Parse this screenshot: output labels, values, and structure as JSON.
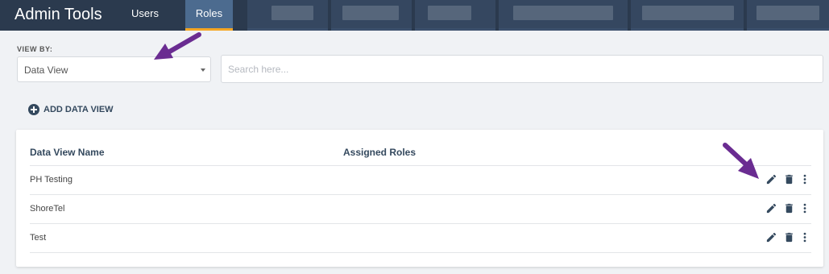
{
  "header": {
    "title": "Admin Tools",
    "tabs": [
      {
        "label": "Users"
      },
      {
        "label": "Roles",
        "active": true
      }
    ],
    "active_tab_color": "#f5a623"
  },
  "filters": {
    "view_by_label": "VIEW BY:",
    "view_by_value": "Data View",
    "search_placeholder": "Search here..."
  },
  "add_button": {
    "label": "ADD DATA VIEW"
  },
  "table": {
    "columns": [
      "Data View Name",
      "Assigned Roles"
    ],
    "rows": [
      {
        "name": "PH Testing",
        "roles": ""
      },
      {
        "name": "ShoreTel",
        "roles": ""
      },
      {
        "name": "Test",
        "roles": ""
      }
    ],
    "row_actions": [
      "pencil-icon",
      "trash-icon",
      "more-vertical-icon"
    ]
  },
  "annotation_color": "#6a2c91"
}
